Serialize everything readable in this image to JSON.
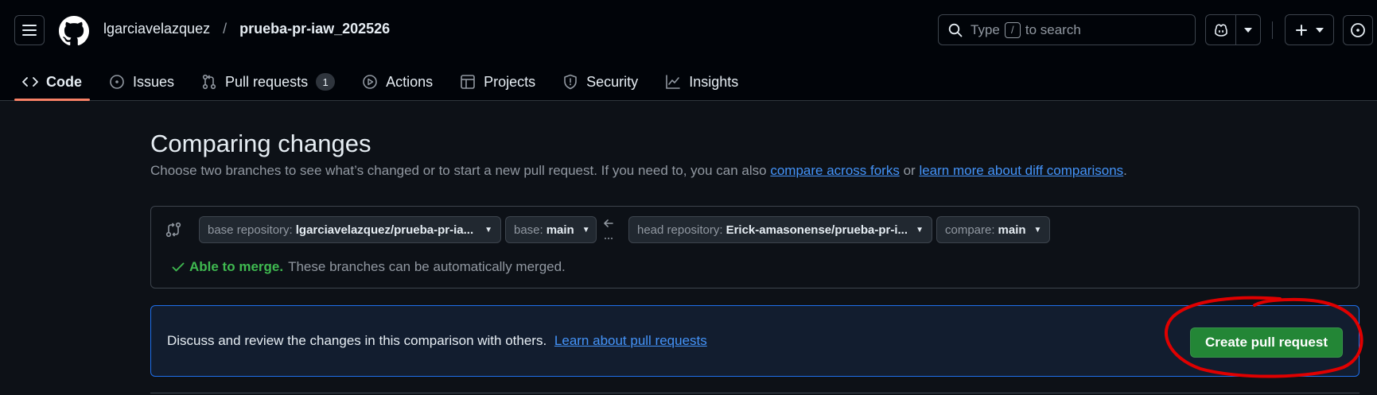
{
  "breadcrumb": {
    "owner": "lgarciavelazquez",
    "separator": "/",
    "repo": "prueba-pr-iaw_202526"
  },
  "search": {
    "prefix": "Type",
    "key": "/",
    "suffix": "to search"
  },
  "tabs": [
    {
      "label": "Code",
      "icon": "code-icon",
      "active": true
    },
    {
      "label": "Issues",
      "icon": "issue-opened-icon"
    },
    {
      "label": "Pull requests",
      "icon": "git-pull-request-icon",
      "count": "1"
    },
    {
      "label": "Actions",
      "icon": "play-icon"
    },
    {
      "label": "Projects",
      "icon": "table-icon"
    },
    {
      "label": "Security",
      "icon": "shield-icon"
    },
    {
      "label": "Insights",
      "icon": "graph-icon"
    }
  ],
  "compare": {
    "title": "Comparing changes",
    "subtitle_text": "Choose two branches to see what’s changed or to start a new pull request. If you need to, you can also",
    "link_forks": "compare across forks",
    "or_text": "or",
    "link_learn_diff": "learn more about diff comparisons",
    "period": ".",
    "base_repo_label": "base repository:",
    "base_repo_value": "lgarciavelazquez/prueba-pr-ia...",
    "base_label": "base:",
    "base_value": "main",
    "head_repo_label": "head repository:",
    "head_repo_value": "Erick-amasonense/prueba-pr-i...",
    "compare_label": "compare:",
    "compare_value": "main",
    "merge_ok": "Able to merge.",
    "merge_text": "These branches can be automatically merged."
  },
  "pr_box": {
    "text": "Discuss and review the changes in this comparison with others.",
    "link": "Learn about pull requests",
    "button": "Create pull request"
  },
  "colors": {
    "accent_link": "#4493f8",
    "button_green": "#238636",
    "tab_underline": "#f78166",
    "annotation_red": "#e00000",
    "merge_green": "#3fb950"
  }
}
